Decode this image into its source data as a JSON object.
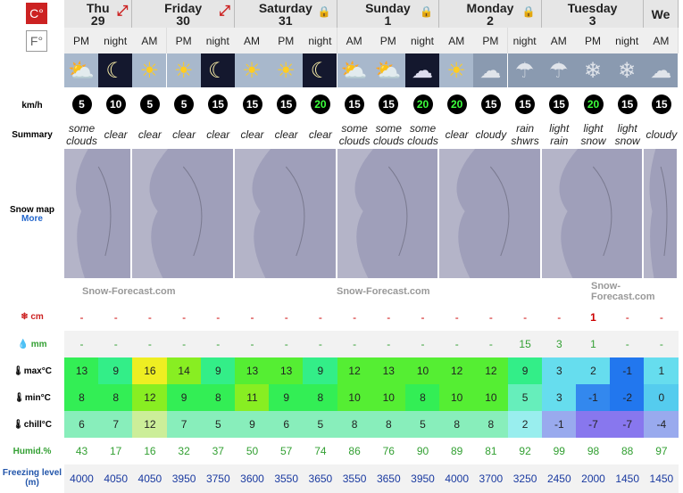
{
  "units": {
    "celsius": "C°",
    "fahrenheit": "F°"
  },
  "row_labels": {
    "wind": "km/h",
    "summary": "Summary",
    "snowmap": "Snow map",
    "more": "More",
    "snow": "cm",
    "rain": "mm",
    "max": "max°C",
    "min": "min°C",
    "chill": "chill°C",
    "humid": "Humid.%",
    "freezing": "Freezing level (m)"
  },
  "watermark": "Snow-Forecast.com",
  "days": [
    {
      "name": "Thu",
      "num": "29",
      "periods": 2
    },
    {
      "name": "Friday",
      "num": "30",
      "periods": 3
    },
    {
      "name": "Saturday",
      "num": "31",
      "periods": 3
    },
    {
      "name": "Sunday",
      "num": "1",
      "periods": 3
    },
    {
      "name": "Monday",
      "num": "2",
      "periods": 3
    },
    {
      "name": "Tuesday",
      "num": "3",
      "periods": 3
    },
    {
      "name": "We",
      "num": "",
      "periods": 1
    }
  ],
  "columns": [
    {
      "tod": "PM",
      "icon": "sun-cloud",
      "wind": "5",
      "summary": [
        "some",
        "clouds"
      ],
      "snow": "-",
      "rain": "-",
      "max": "13",
      "min": "8",
      "chill": "6",
      "humid": "43",
      "freeze": "4000",
      "max_color": "#33ee55",
      "min_color": "#33ee55",
      "chill_color": "#88eebb"
    },
    {
      "tod": "night",
      "icon": "moon",
      "wind": "10",
      "summary": [
        "clear"
      ],
      "snow": "-",
      "rain": "-",
      "max": "9",
      "min": "8",
      "chill": "7",
      "humid": "17",
      "freeze": "4050",
      "max_color": "#33ee88",
      "min_color": "#33ee55",
      "chill_color": "#88eebb"
    },
    {
      "tod": "AM",
      "icon": "sun",
      "wind": "5",
      "summary": [
        "clear"
      ],
      "snow": "-",
      "rain": "-",
      "max": "16",
      "min": "12",
      "chill": "12",
      "humid": "16",
      "freeze": "4050",
      "max_color": "#eeee22",
      "min_color": "#88ee22",
      "chill_color": "#ccee99"
    },
    {
      "tod": "PM",
      "icon": "sun",
      "wind": "5",
      "summary": [
        "clear"
      ],
      "snow": "-",
      "rain": "-",
      "max": "14",
      "min": "9",
      "chill": "7",
      "humid": "32",
      "freeze": "3950",
      "max_color": "#88ee22",
      "min_color": "#33ee55",
      "chill_color": "#88eebb"
    },
    {
      "tod": "night",
      "icon": "moon",
      "wind": "15",
      "summary": [
        "clear"
      ],
      "snow": "-",
      "rain": "-",
      "max": "9",
      "min": "8",
      "chill": "5",
      "humid": "37",
      "freeze": "3750",
      "max_color": "#33ee88",
      "min_color": "#33ee55",
      "chill_color": "#88eebb"
    },
    {
      "tod": "AM",
      "icon": "sun",
      "wind": "15",
      "summary": [
        "clear"
      ],
      "snow": "-",
      "rain": "-",
      "max": "13",
      "min": "11",
      "chill": "9",
      "humid": "50",
      "freeze": "3600",
      "max_color": "#55ee33",
      "min_color": "#88ee22",
      "chill_color": "#88eebb"
    },
    {
      "tod": "PM",
      "icon": "sun",
      "wind": "15",
      "summary": [
        "clear"
      ],
      "snow": "-",
      "rain": "-",
      "max": "13",
      "min": "9",
      "chill": "6",
      "humid": "57",
      "freeze": "3550",
      "max_color": "#55ee33",
      "min_color": "#33ee55",
      "chill_color": "#88eebb"
    },
    {
      "tod": "night",
      "icon": "moon",
      "wind": "20",
      "summary": [
        "clear"
      ],
      "snow": "-",
      "rain": "-",
      "max": "9",
      "min": "8",
      "chill": "5",
      "humid": "74",
      "freeze": "3650",
      "max_color": "#33ee88",
      "min_color": "#33ee55",
      "chill_color": "#88eebb"
    },
    {
      "tod": "AM",
      "icon": "sun-cloud",
      "wind": "15",
      "summary": [
        "some",
        "clouds"
      ],
      "snow": "-",
      "rain": "-",
      "max": "12",
      "min": "10",
      "chill": "8",
      "humid": "86",
      "freeze": "3550",
      "max_color": "#55ee33",
      "min_color": "#55ee33",
      "chill_color": "#88eebb"
    },
    {
      "tod": "PM",
      "icon": "sun-cloud",
      "wind": "15",
      "summary": [
        "some",
        "clouds"
      ],
      "snow": "-",
      "rain": "-",
      "max": "13",
      "min": "10",
      "chill": "8",
      "humid": "76",
      "freeze": "3650",
      "max_color": "#55ee33",
      "min_color": "#55ee33",
      "chill_color": "#88eebb"
    },
    {
      "tod": "night",
      "icon": "moon-cloud",
      "wind": "20",
      "summary": [
        "some",
        "clouds"
      ],
      "snow": "-",
      "rain": "-",
      "max": "10",
      "min": "8",
      "chill": "5",
      "humid": "90",
      "freeze": "3950",
      "max_color": "#55ee33",
      "min_color": "#33ee55",
      "chill_color": "#88eebb"
    },
    {
      "tod": "AM",
      "icon": "sun",
      "wind": "20",
      "summary": [
        "clear"
      ],
      "snow": "-",
      "rain": "-",
      "max": "12",
      "min": "10",
      "chill": "8",
      "humid": "89",
      "freeze": "4000",
      "max_color": "#55ee33",
      "min_color": "#55ee33",
      "chill_color": "#88eebb"
    },
    {
      "tod": "PM",
      "icon": "cloud",
      "wind": "15",
      "summary": [
        "cloudy"
      ],
      "snow": "-",
      "rain": "-",
      "max": "12",
      "min": "10",
      "chill": "8",
      "humid": "81",
      "freeze": "3700",
      "max_color": "#55ee33",
      "min_color": "#55ee33",
      "chill_color": "#88eebb"
    },
    {
      "tod": "night",
      "icon": "rain",
      "wind": "15",
      "summary": [
        "rain",
        "shwrs"
      ],
      "snow": "-",
      "rain": "15",
      "max": "9",
      "min": "5",
      "chill": "2",
      "humid": "92",
      "freeze": "3250",
      "max_color": "#33ee88",
      "min_color": "#66eebb",
      "chill_color": "#99eeee"
    },
    {
      "tod": "AM",
      "icon": "rain-light",
      "wind": "15",
      "summary": [
        "light",
        "rain"
      ],
      "snow": "-",
      "rain": "3",
      "max": "3",
      "min": "3",
      "chill": "-1",
      "humid": "99",
      "freeze": "2450",
      "max_color": "#66ddee",
      "min_color": "#66ddee",
      "chill_color": "#99aaee"
    },
    {
      "tod": "PM",
      "icon": "snow",
      "wind": "20",
      "summary": [
        "light",
        "snow"
      ],
      "snow": "1",
      "rain": "1",
      "max": "2",
      "min": "-1",
      "chill": "-7",
      "humid": "98",
      "freeze": "2000",
      "max_color": "#66ddee",
      "min_color": "#3388ee",
      "chill_color": "#8877ee"
    },
    {
      "tod": "night",
      "icon": "snow",
      "wind": "15",
      "summary": [
        "light",
        "snow"
      ],
      "snow": "-",
      "rain": "-",
      "max": "-1",
      "min": "-2",
      "chill": "-7",
      "humid": "88",
      "freeze": "1450",
      "max_color": "#2277ee",
      "min_color": "#2277ee",
      "chill_color": "#8877ee"
    },
    {
      "tod": "AM",
      "icon": "cloud",
      "wind": "15",
      "summary": [
        "cloudy"
      ],
      "snow": "-",
      "rain": "-",
      "max": "1",
      "min": "0",
      "chill": "-4",
      "humid": "97",
      "freeze": "1450",
      "max_color": "#66ddee",
      "min_color": "#55ccee",
      "chill_color": "#99aaee"
    }
  ]
}
